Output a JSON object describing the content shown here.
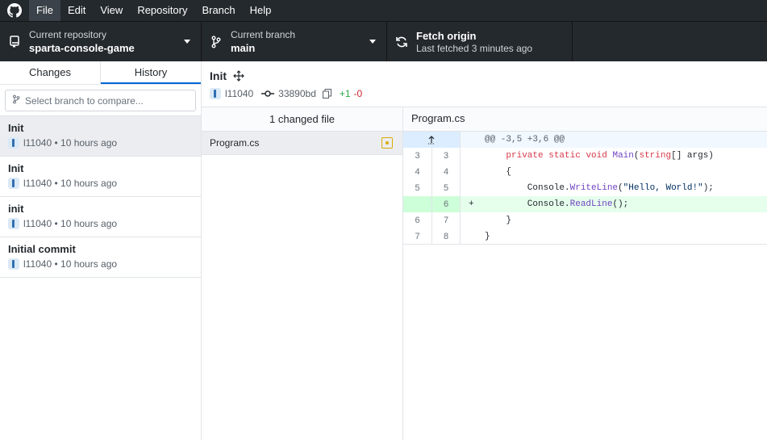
{
  "menu": {
    "items": [
      "File",
      "Edit",
      "View",
      "Repository",
      "Branch",
      "Help"
    ],
    "active": "File"
  },
  "toolbar": {
    "repo_label": "Current repository",
    "repo_name": "sparta-console-game",
    "branch_label": "Current branch",
    "branch_name": "main",
    "fetch_label": "Fetch origin",
    "fetch_status": "Last fetched 3 minutes ago"
  },
  "sidebar": {
    "tabs": [
      "Changes",
      "History"
    ],
    "selected_tab": "History",
    "branch_filter_placeholder": "Select branch to compare...",
    "commits": [
      {
        "summary": "Init",
        "meta": "l11040 • 10 hours ago"
      },
      {
        "summary": "Init",
        "meta": "l11040 • 10 hours ago"
      },
      {
        "summary": "init",
        "meta": "l11040 • 10 hours ago"
      },
      {
        "summary": "Initial commit",
        "meta": "l11040 • 10 hours ago"
      }
    ]
  },
  "commit_header": {
    "title": "Init",
    "author": "l11040",
    "sha": "33890bd",
    "added": "+1",
    "removed": "-0"
  },
  "files": {
    "header": "1 changed file",
    "items": [
      {
        "name": "Program.cs",
        "status": "modified"
      }
    ]
  },
  "diff": {
    "file": "Program.cs",
    "hunk": "@@ -3,5 +3,6 @@",
    "lines": [
      {
        "old": "3",
        "new": "3",
        "marker": "",
        "code": "    private static void Main(string[] args)"
      },
      {
        "old": "4",
        "new": "4",
        "marker": "",
        "code": "    {"
      },
      {
        "old": "5",
        "new": "5",
        "marker": "",
        "code": "        Console.WriteLine(\"Hello, World!\");"
      },
      {
        "old": "",
        "new": "6",
        "marker": "+",
        "code": "        Console.ReadLine();"
      },
      {
        "old": "6",
        "new": "7",
        "marker": "",
        "code": "    }"
      },
      {
        "old": "7",
        "new": "8",
        "marker": "",
        "code": "}"
      }
    ]
  },
  "colors": {
    "chrome": "#24292e",
    "accent": "#0366d6",
    "added": "#28a745",
    "removed": "#cb2431",
    "modified": "#dbab09"
  }
}
